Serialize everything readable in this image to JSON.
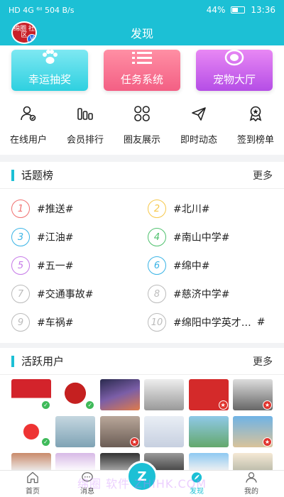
{
  "status": {
    "left": "HD 4G ⁶ⁱˡ 504 B/s",
    "battery": "44%",
    "time": "13:36"
  },
  "header": {
    "title": "发现",
    "logo_text": "绵圈\n社区"
  },
  "features": [
    {
      "label": "幸运抽奖",
      "icon": "paw-icon"
    },
    {
      "label": "任务系统",
      "icon": "list-icon"
    },
    {
      "label": "宠物大厅",
      "icon": "pet-icon"
    }
  ],
  "quick_nav": [
    {
      "label": "在线用户",
      "icon": "user-online-icon"
    },
    {
      "label": "会员排行",
      "icon": "bar-chart-icon"
    },
    {
      "label": "圈友展示",
      "icon": "grid-icon"
    },
    {
      "label": "即时动态",
      "icon": "plane-icon"
    },
    {
      "label": "签到榜单",
      "icon": "medal-icon"
    }
  ],
  "topics": {
    "title": "话题榜",
    "more": "更多",
    "items": [
      {
        "rank": "1",
        "text": "#推送#",
        "color": "#f07070"
      },
      {
        "rank": "2",
        "text": "#北川#",
        "color": "#f6c84b"
      },
      {
        "rank": "3",
        "text": "#江油#",
        "color": "#3ab4e6"
      },
      {
        "rank": "4",
        "text": "#南山中学#",
        "color": "#4fc16e"
      },
      {
        "rank": "5",
        "text": "#五一#",
        "color": "#c67ae8"
      },
      {
        "rank": "6",
        "text": "#绵中#",
        "color": "#3ab4e6"
      },
      {
        "rank": "7",
        "text": "#交通事故#",
        "color": "#bbbbbb"
      },
      {
        "rank": "8",
        "text": "#慈济中学#",
        "color": "#bbbbbb"
      },
      {
        "rank": "9",
        "text": "#车祸#",
        "color": "#bbbbbb"
      },
      {
        "rank": "10",
        "text": "#绵阳中学英才…",
        "color": "#bbbbbb",
        "suffix": "#"
      }
    ]
  },
  "users": {
    "title": "活跃用户",
    "more": "更多"
  },
  "bottom_nav": [
    {
      "label": "首页",
      "icon": "home-icon"
    },
    {
      "label": "消息",
      "icon": "message-icon"
    },
    {
      "label": "",
      "icon": "center-logo-icon",
      "text": "Z"
    },
    {
      "label": "发现",
      "icon": "discover-icon",
      "active": true
    },
    {
      "label": "我的",
      "icon": "profile-icon"
    }
  ],
  "watermark": "绵圈 软件 ZHIHK.COM",
  "colors": {
    "accent": "#1cc0d5"
  }
}
